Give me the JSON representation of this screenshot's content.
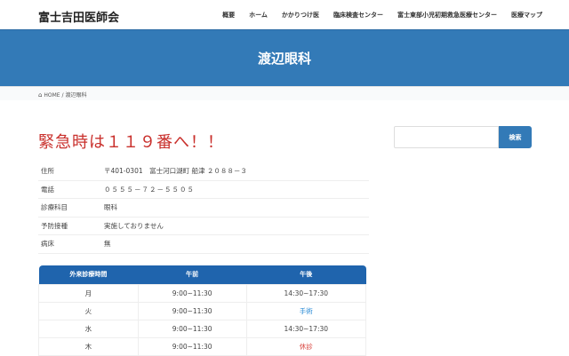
{
  "site_title": "富士吉田医師会",
  "nav": [
    "概要",
    "ホーム",
    "かかりつけ医",
    "臨床検査センター",
    "富士東部小児初期救急医療センター",
    "医療マップ"
  ],
  "page_title": "渡辺眼科",
  "breadcrumb": {
    "home": "HOME",
    "sep": "/",
    "current": "渡辺眼科"
  },
  "emergency": "緊急時は１１９番へ！！",
  "info": [
    {
      "label": "住所",
      "value": "〒401-0301　富士河口湖町 船津 ２０８８－３"
    },
    {
      "label": "電話",
      "value": "０５５５－７２－５５０５"
    },
    {
      "label": "診療科目",
      "value": "眼科"
    },
    {
      "label": "予防接種",
      "value": "実施しておりません"
    },
    {
      "label": "病床",
      "value": "無"
    }
  ],
  "hours": {
    "headers": [
      "外来診療時間",
      "午前",
      "午後"
    ],
    "rows": [
      [
        "月",
        "9:00~11:30",
        "14:30~17:30"
      ],
      [
        "火",
        "9:00~11:30",
        "手術"
      ],
      [
        "水",
        "9:00~11:30",
        "14:30~17:30"
      ],
      [
        "木",
        "9:00~11:30",
        "休診"
      ]
    ]
  },
  "search": {
    "placeholder": "",
    "button": "検索"
  }
}
